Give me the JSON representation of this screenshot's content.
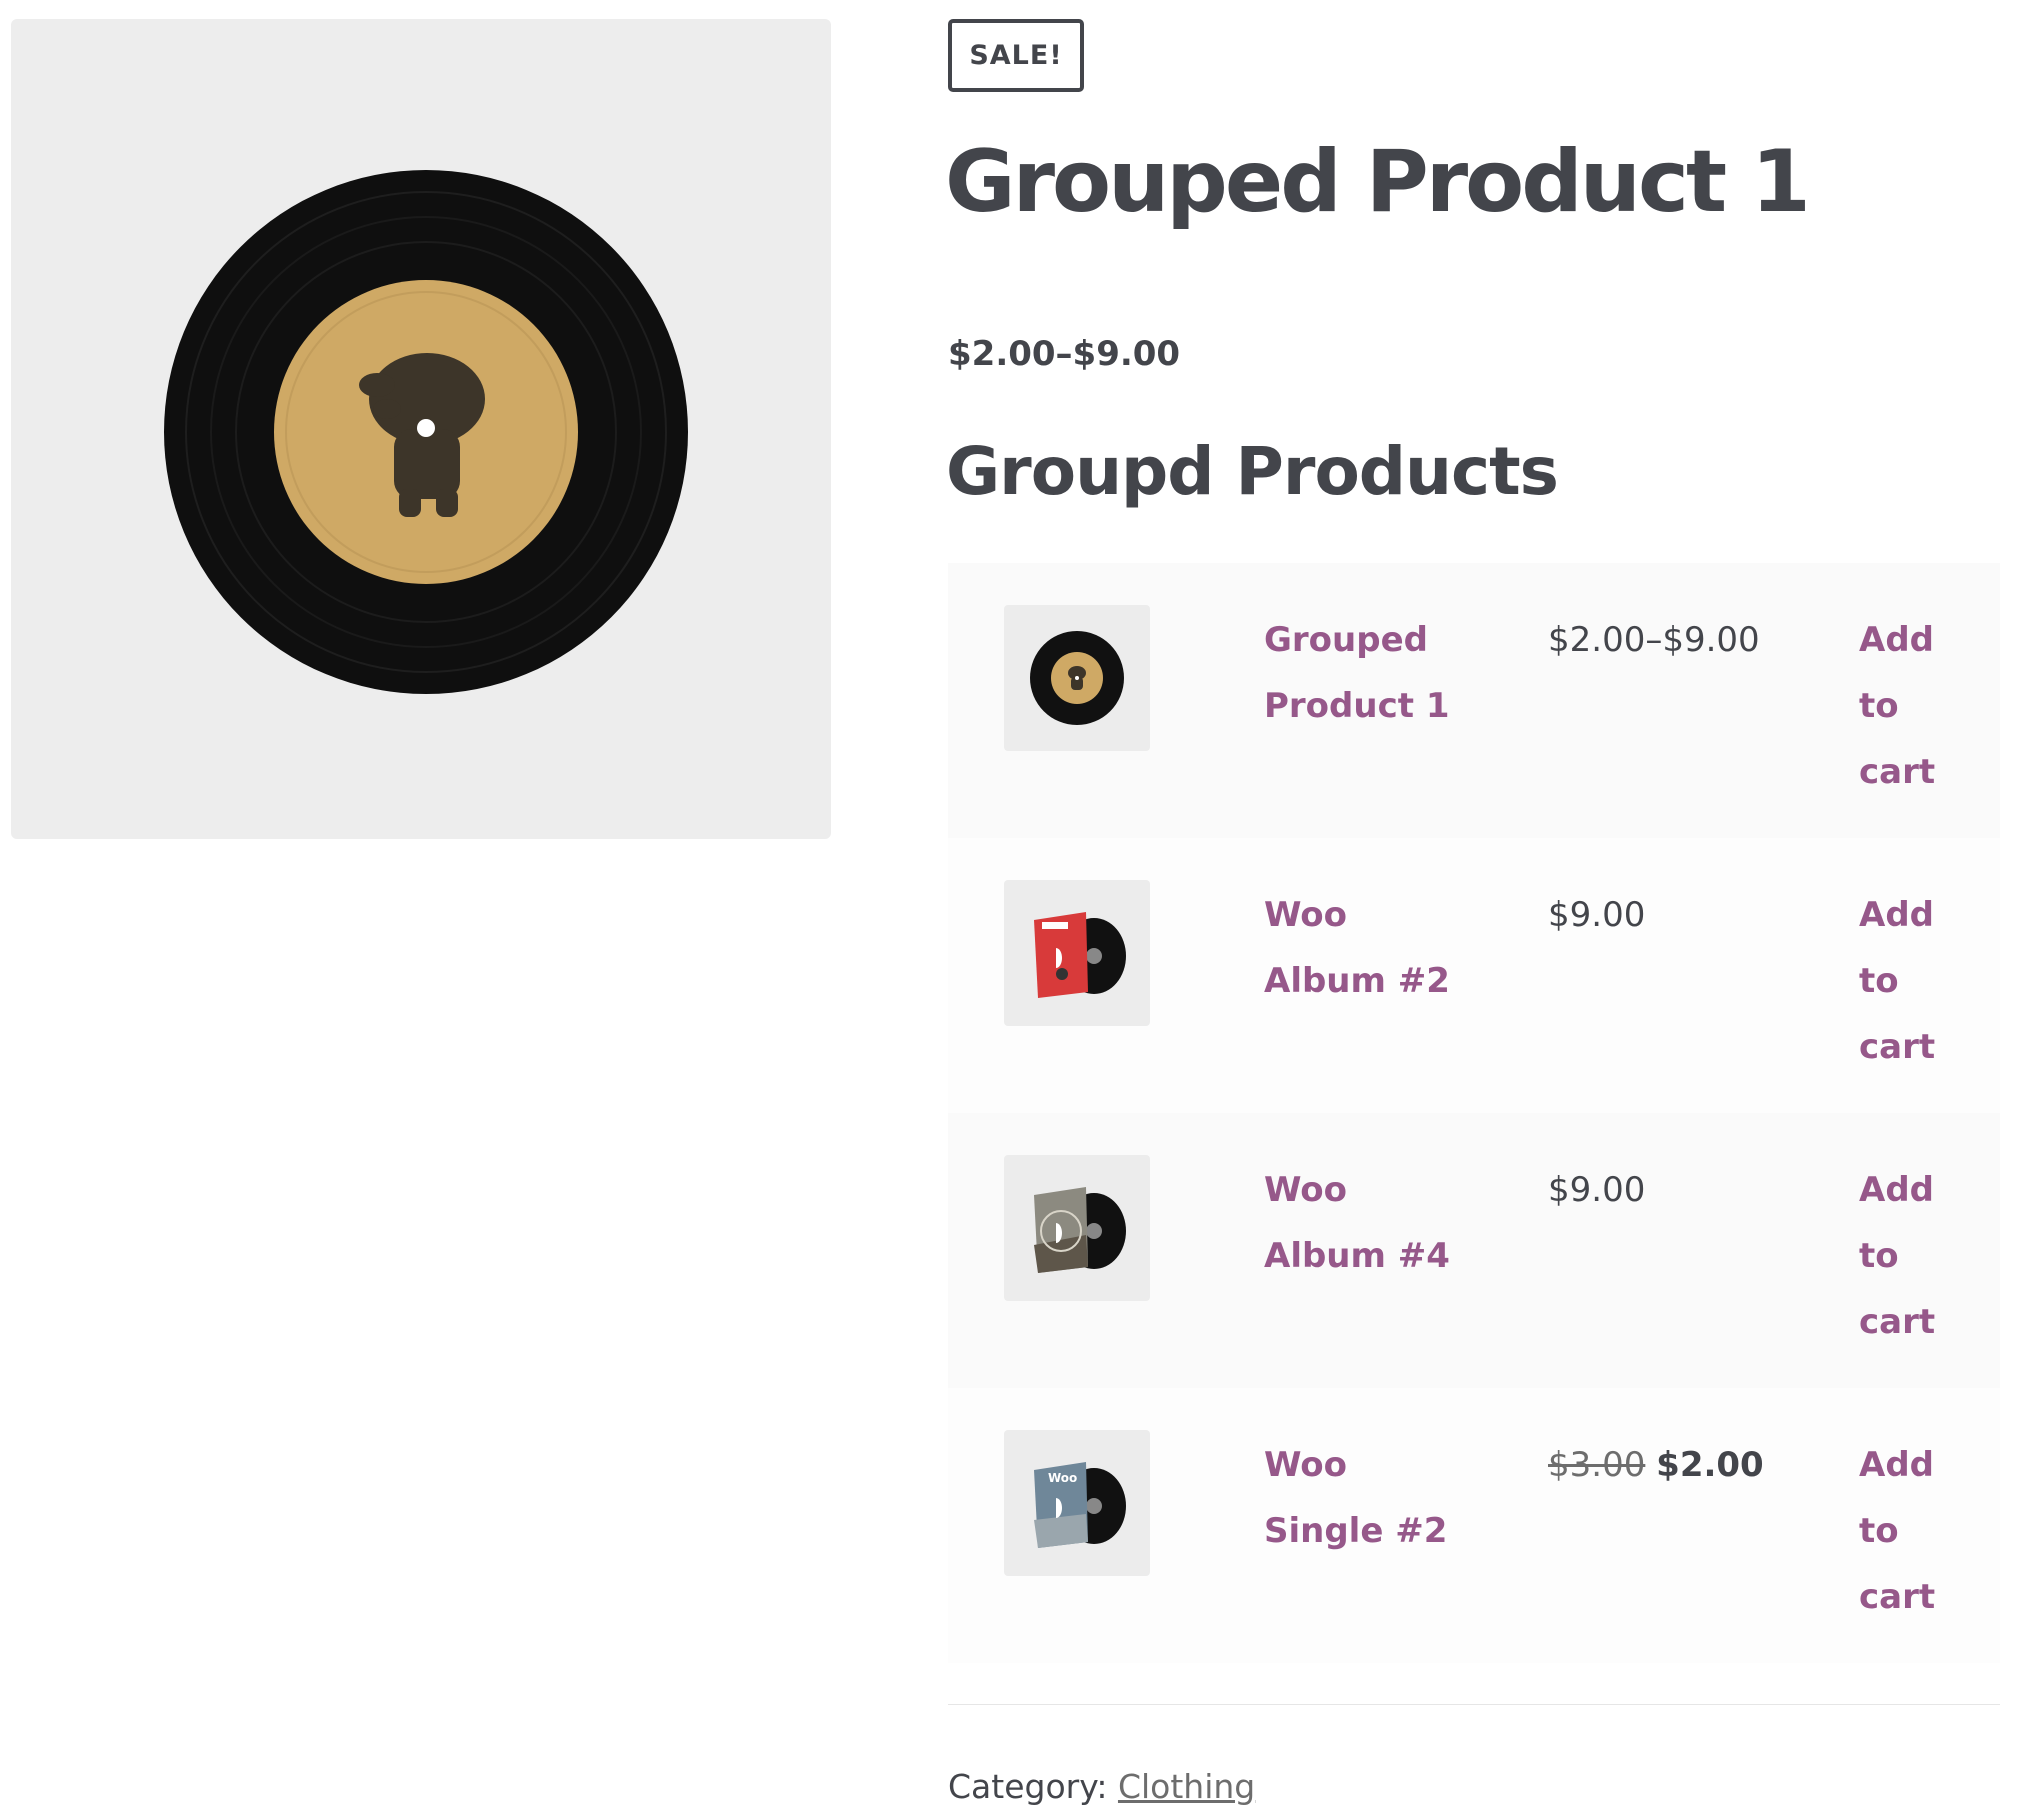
{
  "product": {
    "sale_badge": "SALE!",
    "title": "Grouped Product 1",
    "price_range": "$2.00–$9.00",
    "image_icon": "vinyl-record-image"
  },
  "grouped": {
    "heading": "Groupd Products",
    "items": [
      {
        "name": "Grouped Product 1",
        "price": "$2.00–$9.00",
        "action": "Add to cart",
        "thumb_icon": "vinyl-record-thumb"
      },
      {
        "name": "Woo Album #2",
        "price": "$9.00",
        "action": "Add to cart",
        "thumb_icon": "album-red-sleeve-thumb"
      },
      {
        "name": "Woo Album #4",
        "price": "$9.00",
        "action": "Add to cart",
        "thumb_icon": "album-grey-sleeve-thumb"
      },
      {
        "name": "Woo Single #2",
        "price_regular": "$3.00",
        "price_sale": "$2.00",
        "action": "Add to cart",
        "thumb_icon": "single-blue-sleeve-thumb"
      }
    ]
  },
  "meta": {
    "category_label": "Category:",
    "category_link": "Clothing"
  },
  "colors": {
    "text": "#43454b",
    "link": "#96588a",
    "gallery_bg": "#ededed",
    "label_gold": "#c9a86b"
  }
}
